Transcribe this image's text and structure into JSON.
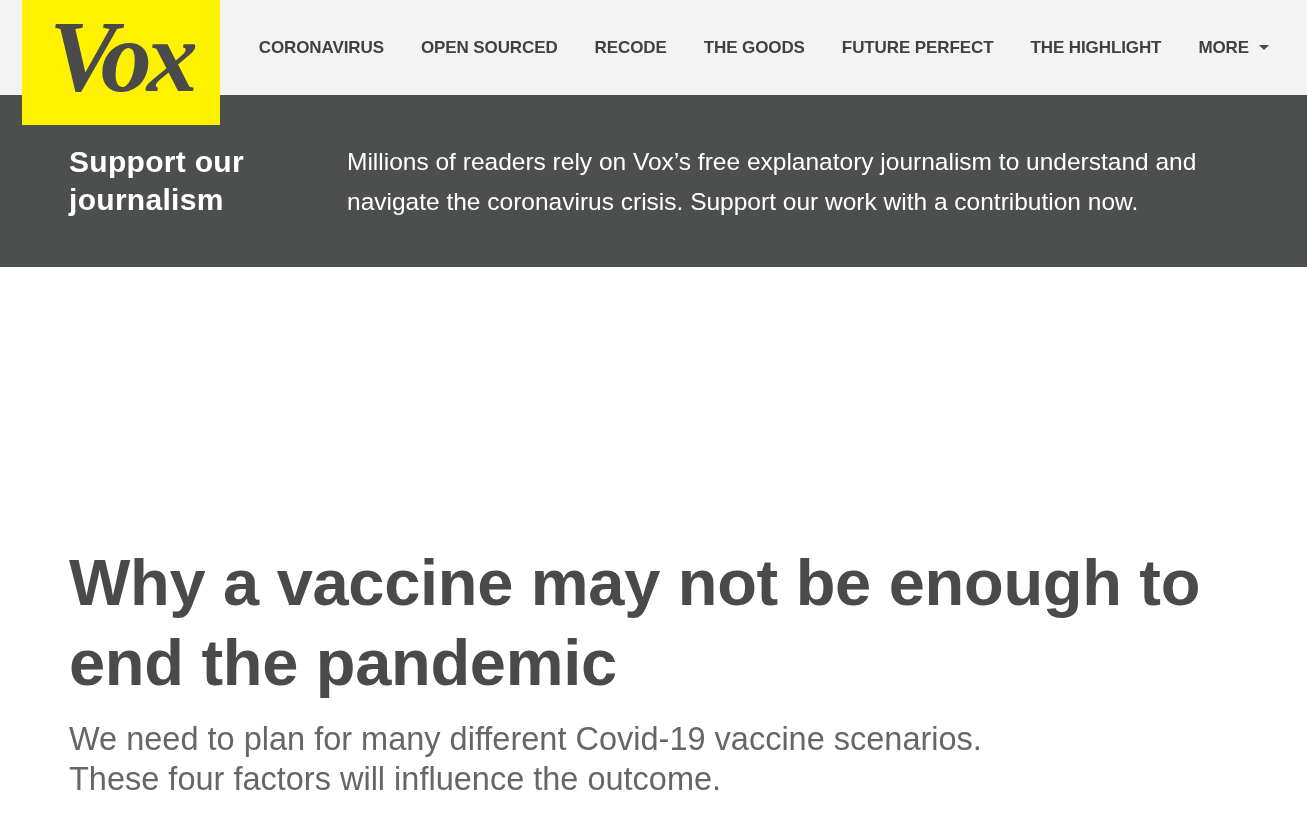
{
  "header": {
    "logo": "Vox",
    "nav_items": [
      {
        "label": "CORONAVIRUS",
        "kind": "link"
      },
      {
        "label": "OPEN SOURCED",
        "kind": "link"
      },
      {
        "label": "RECODE",
        "kind": "link"
      },
      {
        "label": "THE GOODS",
        "kind": "link"
      },
      {
        "label": "FUTURE PERFECT",
        "kind": "link"
      },
      {
        "label": "THE HIGHLIGHT",
        "kind": "link"
      },
      {
        "label": "MORE",
        "kind": "menu"
      }
    ]
  },
  "support_banner": {
    "heading": "Support our journalism",
    "message": "Millions of readers rely on Vox’s free explanatory journalism to understand and navigate the coronavirus crisis. Support our work with a contribution now."
  },
  "article": {
    "headline": "Why a vaccine may not be enough to end the pandemic",
    "dek": "We need to plan for many different Covid-19 vaccine scenarios. These four factors will influence the outcome."
  }
}
